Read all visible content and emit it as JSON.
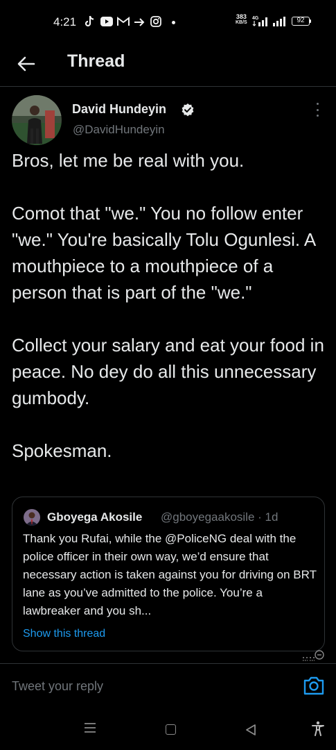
{
  "status_bar": {
    "time": "4:21",
    "net_speed_value": "383",
    "net_speed_unit": "KB/S",
    "network_type": "4G",
    "battery": "92"
  },
  "header": {
    "title": "Thread"
  },
  "tweet": {
    "author_name": "David Hundeyin",
    "author_handle": "@DavidHundeyin",
    "paragraphs": [
      "Bros, let me be real with you.",
      "Comot that \"we.\" You no follow enter \"we.\" You're basically Tolu Ogunlesi. A mouthpiece to a mouthpiece of a person that is part of the \"we.\"",
      "Collect your salary and eat your food in peace. No dey do all this unnecessary gumbody.",
      "Spokesman."
    ]
  },
  "quote": {
    "author_name": "Gboyega Akosile",
    "author_handle": "@gboyegaakosile",
    "separator": "·",
    "age": "1d",
    "text": "Thank you Rufai, while the @PoliceNG deal with the police officer in their own way, we’d ensure that necessary action is taken against you for driving on BRT lane as you’ve admitted to the police. You’re a lawbreaker and you sh...",
    "link_label": "Show this thread"
  },
  "reply": {
    "placeholder": "Tweet your reply"
  },
  "icons": {
    "back": "arrow-left-icon",
    "verified": "verified-badge-icon",
    "more": "more-vertical-icon",
    "camera": "camera-icon",
    "counter": "character-counter-icon"
  },
  "colors": {
    "background": "#000000",
    "text_primary": "#e7e9ea",
    "text_secondary": "#71767b",
    "accent": "#1d9bf0",
    "divider": "#2f3336"
  }
}
